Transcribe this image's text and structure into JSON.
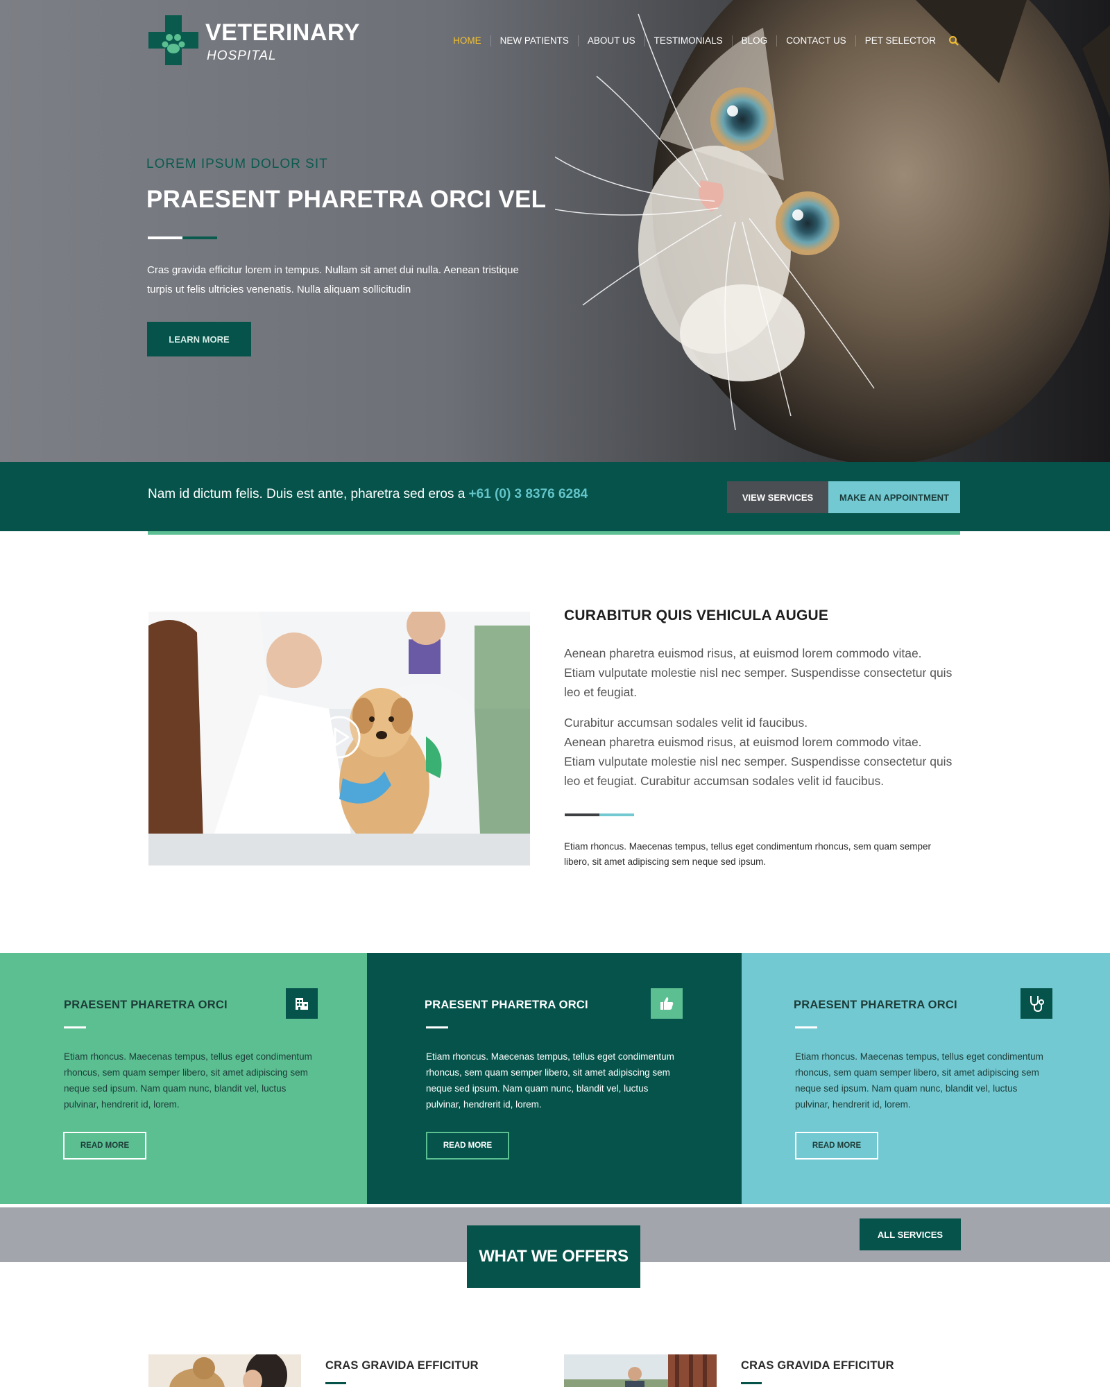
{
  "brand": {
    "name_line1": "VETERINARY",
    "name_line2": "HOSPITAL",
    "colors": {
      "primary": "#05534a",
      "green": "#5bbf92",
      "teal": "#72c9d2",
      "accent_yellow": "#f6c12f"
    }
  },
  "nav": {
    "items": [
      {
        "label": "HOME",
        "active": true
      },
      {
        "label": "NEW PATIENTS",
        "active": false
      },
      {
        "label": "ABOUT US",
        "active": false
      },
      {
        "label": "TESTIMONIALS",
        "active": false
      },
      {
        "label": "BLOG",
        "active": false
      },
      {
        "label": "CONTACT US",
        "active": false
      },
      {
        "label": "PET SELECTOR",
        "active": false
      }
    ],
    "search_icon": "search-icon"
  },
  "hero": {
    "kicker": "LOREM IPSUM DOLOR SIT",
    "title": "PRAESENT PHARETRA ORCI VEL",
    "text": "Cras gravida efficitur lorem in tempus. Nullam sit amet dui nulla. Aenean tristique turpis ut felis ultricies venenatis. Nulla aliquam sollicitudin",
    "button": "LEARN MORE"
  },
  "callbar": {
    "text": "Nam id dictum felis. Duis est ante, pharetra sed eros a",
    "phone": "+61 (0) 3 8376 6284",
    "btn_services": "VIEW SERVICES",
    "btn_appointment": "MAKE AN APPOINTMENT"
  },
  "about": {
    "title": "CURABITUR QUIS VEHICULA AUGUE",
    "p1": "Aenean pharetra euismod risus, at euismod lorem commodo vitae. Etiam vulputate molestie nisl nec semper. Suspendisse consectetur quis leo et feugiat.",
    "p2_line1": "Curabitur accumsan sodales velit id faucibus.",
    "p2_rest": "Aenean pharetra euismod risus, at euismod lorem commodo vitae. Etiam vulputate molestie nisl nec semper. Suspendisse consectetur quis leo et feugiat. Curabitur accumsan sodales velit id faucibus.",
    "small": "Etiam rhoncus. Maecenas tempus, tellus eget condimentum rhoncus, sem quam semper libero, sit amet adipiscing sem neque sed ipsum."
  },
  "cards": [
    {
      "title": "PRAESENT PHARETRA ORCI",
      "icon": "hospital-building-icon",
      "text": "Etiam rhoncus. Maecenas tempus, tellus eget condimentum rhoncus, sem quam semper libero, sit amet adipiscing sem neque sed ipsum. Nam quam nunc, blandit vel, luctus pulvinar, hendrerit id, lorem.",
      "button": "READ MORE"
    },
    {
      "title": "PRAESENT PHARETRA ORCI",
      "icon": "thumbs-up-icon",
      "text": "Etiam rhoncus. Maecenas tempus, tellus eget condimentum rhoncus, sem quam semper libero, sit amet adipiscing sem neque sed ipsum. Nam quam nunc, blandit vel, luctus pulvinar, hendrerit id, lorem.",
      "button": "READ MORE"
    },
    {
      "title": "PRAESENT PHARETRA ORCI",
      "icon": "stethoscope-icon",
      "text": "Etiam rhoncus. Maecenas tempus, tellus eget condimentum rhoncus, sem quam semper libero, sit amet adipiscing sem neque sed ipsum. Nam quam nunc, blandit vel, luctus pulvinar, hendrerit id, lorem.",
      "button": "READ MORE"
    }
  ],
  "offers": {
    "heading": "WHAT WE OFFERS",
    "button": "ALL SERVICES",
    "items": [
      {
        "title": "CRAS GRAVIDA EFFICITUR"
      },
      {
        "title": "CRAS GRAVIDA EFFICITUR"
      }
    ]
  }
}
